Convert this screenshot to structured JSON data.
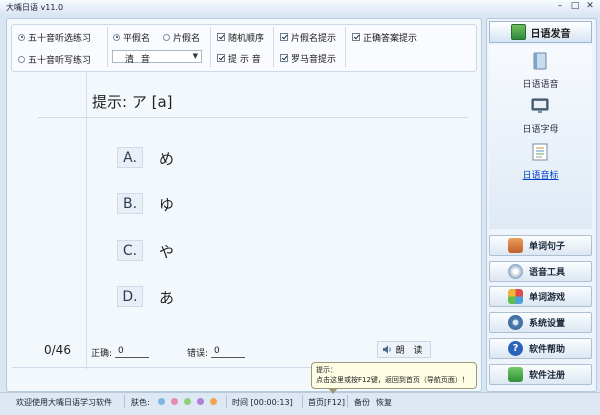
{
  "window": {
    "title": "大嘴日语 v11.0",
    "controls": [
      "minimize-icon",
      "maximize-icon",
      "close-icon"
    ]
  },
  "toolbar": {
    "mode_select": "五十音听选练习",
    "mode_write": "五十音听写练习",
    "hiragana": "平假名",
    "katakana": "片假名",
    "random_order": "随机顺序",
    "prompt_sound": "提 示 音",
    "katakana_hint": "片假名提示",
    "romaji_hint": "罗马音提示",
    "correct_hint": "正确答案提示",
    "category_value": "清  音"
  },
  "quiz": {
    "hint": "提示: ア [a]",
    "choices": [
      {
        "letter": "A.",
        "kana": "め"
      },
      {
        "letter": "B.",
        "kana": "ゆ"
      },
      {
        "letter": "C.",
        "kana": "や"
      },
      {
        "letter": "D.",
        "kana": "あ"
      }
    ],
    "progress": "0/46",
    "correct_label": "正确:",
    "correct_value": "0",
    "wrong_label": "错误:",
    "wrong_value": "0",
    "read_button": "朗 读"
  },
  "sidebar": {
    "header": "日语发音",
    "subitems": [
      {
        "label": "日语语音",
        "icon": "book-icon"
      },
      {
        "label": "日语字母",
        "icon": "monitor-icon"
      },
      {
        "label": "日语音标",
        "icon": "document-icon",
        "active": true
      }
    ],
    "buttons": [
      {
        "label": "单词句子",
        "icon": "books-icon"
      },
      {
        "label": "语音工具",
        "icon": "cd-tool-icon"
      },
      {
        "label": "单词游戏",
        "icon": "puzzle-icon"
      },
      {
        "label": "系统设置",
        "icon": "gears-icon"
      },
      {
        "label": "软件帮助",
        "icon": "help-icon"
      },
      {
        "label": "软件注册",
        "icon": "register-icon"
      }
    ]
  },
  "status": {
    "welcome": "欢迎使用大嘴日语学习软件",
    "skin_label": "肤色:",
    "skin_colors": [
      "#7fb6e0",
      "#e58ab0",
      "#8fd07a",
      "#b07fd6",
      "#f0a64a"
    ],
    "time": "时间 [00:00:13]",
    "home": "首页[F12]",
    "backup": "备份",
    "restore": "恢复"
  },
  "tooltip": {
    "title": "提示：",
    "text": "点击这里或按F12键，返回到首页（导航页面）！"
  }
}
